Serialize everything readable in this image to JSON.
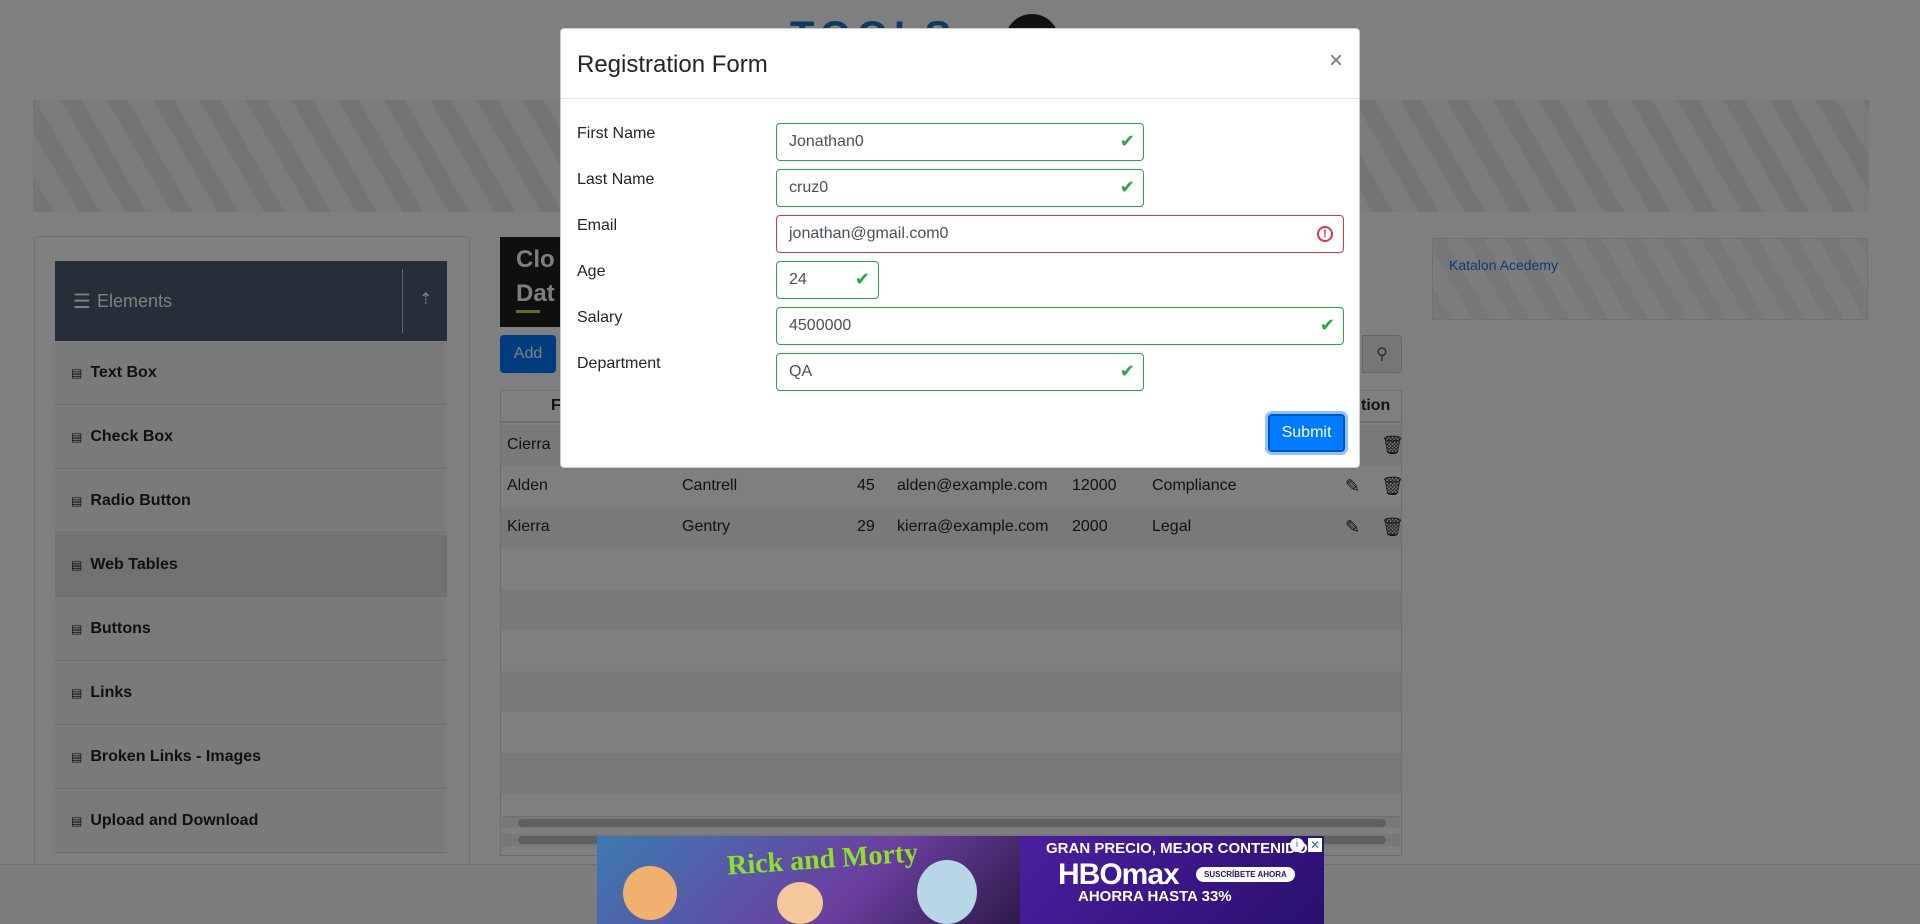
{
  "sidebar": {
    "group_title": "Elements",
    "items": [
      {
        "label": "Text Box"
      },
      {
        "label": "Check Box"
      },
      {
        "label": "Radio Button"
      },
      {
        "label": "Web Tables",
        "active": true
      },
      {
        "label": "Buttons"
      },
      {
        "label": "Links"
      },
      {
        "label": "Broken Links - Images"
      },
      {
        "label": "Upload and Download"
      }
    ]
  },
  "page": {
    "header_text": "Clo Dat",
    "add_button": "Add",
    "side_ad_link": "Katalon Acedemy"
  },
  "table": {
    "headers": [
      "Fi",
      "tion"
    ],
    "rows": [
      {
        "first": "Cierra",
        "last": "",
        "age": "",
        "email": "",
        "salary": "",
        "department": ""
      },
      {
        "first": "Alden",
        "last": "Cantrell",
        "age": "45",
        "email": "alden@example.com",
        "salary": "12000",
        "department": "Compliance"
      },
      {
        "first": "Kierra",
        "last": "Gentry",
        "age": "29",
        "email": "kierra@example.com",
        "salary": "2000",
        "department": "Legal"
      }
    ]
  },
  "modal": {
    "title": "Registration Form",
    "close": "×",
    "fields": {
      "first_name": {
        "label": "First Name",
        "value": "Jonathan0",
        "valid": true
      },
      "last_name": {
        "label": "Last Name",
        "value": "cruz0",
        "valid": true
      },
      "email": {
        "label": "Email",
        "value": "jonathan@gmail.com0",
        "valid": false
      },
      "age": {
        "label": "Age",
        "value": "24",
        "valid": true
      },
      "salary": {
        "label": "Salary",
        "value": "4500000",
        "valid": true
      },
      "department": {
        "label": "Department",
        "value": "QA",
        "valid": true
      }
    },
    "submit": "Submit"
  },
  "bottom_ad": {
    "show_title": "Rick and Morty",
    "headline": "GRAN PRECIO, MEJOR CONTENIDO",
    "brand": "HBOmax",
    "cta": "SUSCRÍBETE AHORA",
    "offer": "AHORRA HASTA 33%"
  },
  "colors": {
    "primary": "#007bff",
    "valid": "#28a745",
    "invalid": "#dc3545",
    "sidebar_header": "#4b5d73"
  }
}
